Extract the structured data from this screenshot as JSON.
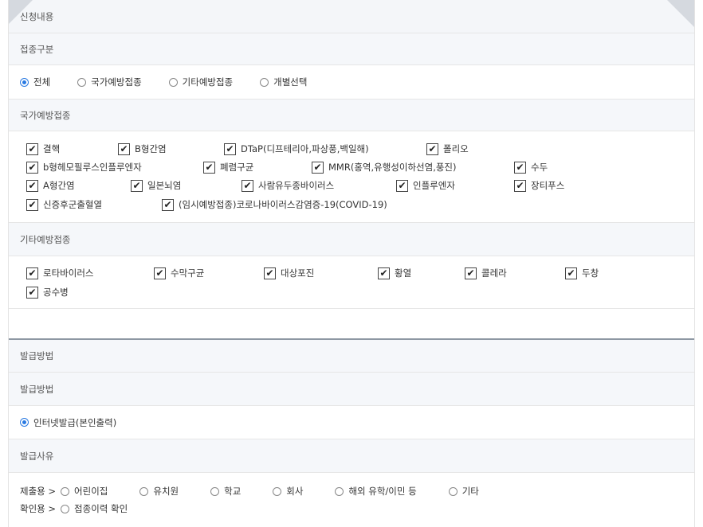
{
  "header": {
    "title": "신청내용"
  },
  "vaccine_type": {
    "title": "접종구분",
    "options": [
      "전체",
      "국가예방접종",
      "기타예방접종",
      "개별선택"
    ],
    "selected": "전체"
  },
  "national": {
    "title": "국가예방접종",
    "items": [
      "결핵",
      "B형간염",
      "DTaP(디프테리아,파상풍,백일해)",
      "폴리오",
      "b형헤모필루스인플루엔자",
      "폐렴구균",
      "MMR(홍역,유행성이하선염,풍진)",
      "수두",
      "A형간염",
      "일본뇌염",
      "사람유두종바이러스",
      "인플루엔자",
      "장티푸스",
      "신증후군출혈열",
      "(임시예방접종)코로나바이러스감염증-19(COVID-19)"
    ]
  },
  "other": {
    "title": "기타예방접종",
    "items": [
      "로타바이러스",
      "수막구균",
      "대상포진",
      "황열",
      "콜레라",
      "두창",
      "공수병"
    ]
  },
  "issue": {
    "section_title": "발급방법",
    "method_title": "발급방법",
    "method_option": "인터넷발급(본인출력)",
    "reason_title": "발급사유",
    "submit_label": "제출용 >",
    "submit_options": [
      "어린이집",
      "유치원",
      "학교",
      "회사",
      "해외 유학/이민 등",
      "기타"
    ],
    "confirm_label": "확인용 >",
    "confirm_options": [
      "접종이력 확인"
    ]
  },
  "check_mark": "✔"
}
